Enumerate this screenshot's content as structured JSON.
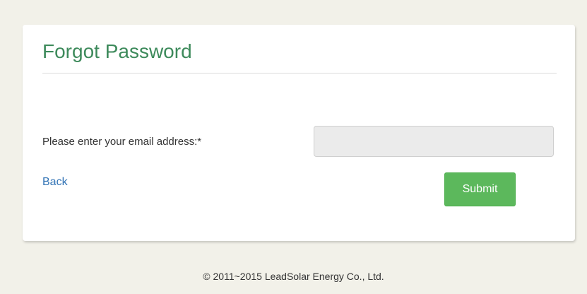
{
  "form": {
    "title": "Forgot Password",
    "email_label": "Please enter your email address:*",
    "email_value": "",
    "email_placeholder": "",
    "back_label": "Back",
    "submit_label": "Submit"
  },
  "footer": {
    "copyright": "© 2011~2015 LeadSolar Energy Co., Ltd."
  },
  "colors": {
    "page_background": "#f2f1e9",
    "title": "#3d8a5b",
    "link": "#3173b5",
    "submit_button": "#5cb85c"
  }
}
